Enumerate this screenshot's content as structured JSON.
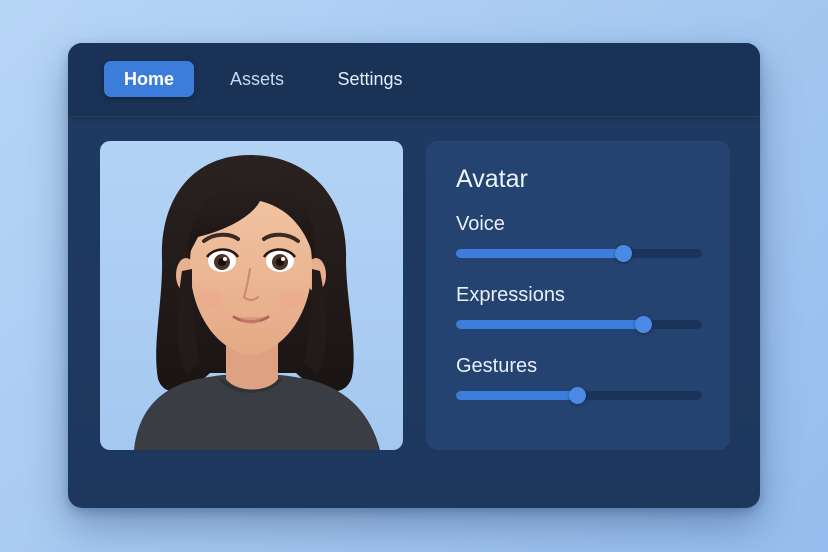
{
  "tabs": [
    {
      "label": "Home",
      "active": true
    },
    {
      "label": "Assets",
      "active": false
    },
    {
      "label": "Settings",
      "active": false
    }
  ],
  "panel": {
    "title": "Avatar",
    "controls": [
      {
        "label": "Voice",
        "value": 0.68
      },
      {
        "label": "Expressions",
        "value": 0.76
      },
      {
        "label": "Gestures",
        "value": 0.49
      }
    ]
  },
  "colors": {
    "accent": "#3c7ddb",
    "window_bg": "#1f3a63",
    "panel_bg": "#244370",
    "track_bg": "#1c345a",
    "page_bg": "#a6c9f1"
  },
  "avatar": {
    "icon": "avatar-portrait-illustration"
  }
}
